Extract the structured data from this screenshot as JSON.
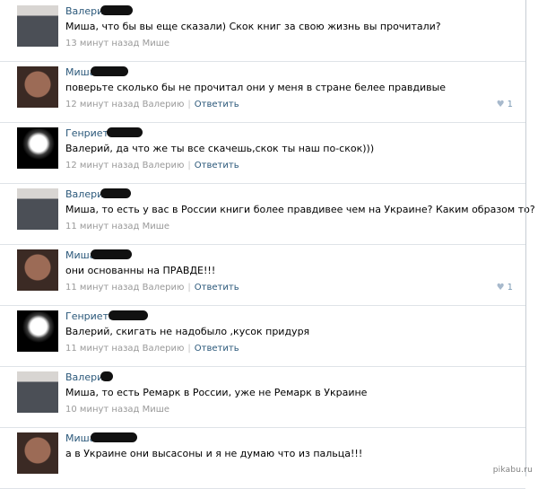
{
  "comments": [
    {
      "author": "Валерий",
      "text": "Миша, что бы вы еще сказали) Скок книг за свою жизнь вы прочитали?",
      "time": "13 минут назад Мише",
      "reply": "",
      "likes": "",
      "avatar": "suit"
    },
    {
      "author": "Миша",
      "text": "поверьте сколько бы не прочитал они у меня в стране белее правдивые",
      "time": "12 минут назад Валерию",
      "reply": "Ответить",
      "likes": "1",
      "avatar": "face"
    },
    {
      "author": "Генриета",
      "text": "Валерий, да что же ты все скачешь,скок ты наш по-скок)))",
      "time": "12 минут назад Валерию",
      "reply": "Ответить",
      "likes": "",
      "avatar": "flower"
    },
    {
      "author": "Валерий",
      "text": "Миша, то есть у вас в России книги более правдивее чем на Украине? Каким образом то?",
      "time": "11 минут назад Мише",
      "reply": "",
      "likes": "",
      "avatar": "suit"
    },
    {
      "author": "Миша",
      "text": "они основанны на ПРАВДЕ!!!",
      "time": "11 минут назад Валерию",
      "reply": "Ответить",
      "likes": "1",
      "avatar": "face"
    },
    {
      "author": "Генриета",
      "text": "Валерий, скигать не надобыло ,кусок придуря",
      "time": "11 минут назад Валерию",
      "reply": "Ответить",
      "likes": "",
      "avatar": "flower"
    },
    {
      "author": "Валерий",
      "text": "Миша, то есть Ремарк в России, уже не Ремарк в Украине",
      "time": "10 минут назад Мише",
      "reply": "",
      "likes": "",
      "avatar": "suit"
    },
    {
      "author": "Миша",
      "text": "а в Украине они высасоны и я не думаю что из пальца!!!",
      "time": "",
      "reply": "",
      "likes": "",
      "avatar": "face"
    }
  ],
  "watermark": "pikabu.ru",
  "icons": {
    "like": "heart-icon"
  },
  "colors": {
    "author": "#2b587a",
    "meta": "#999999",
    "like": "#7898b3"
  }
}
